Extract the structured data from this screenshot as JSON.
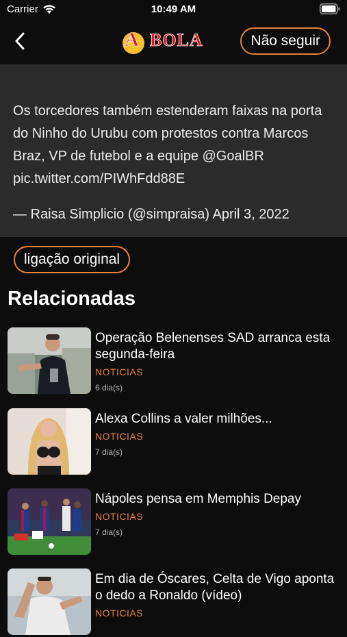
{
  "status_bar": {
    "carrier": "Carrier",
    "time": "10:49 AM"
  },
  "nav": {
    "logo_text": "A BOLA",
    "follow_label": "Não seguir"
  },
  "tweet": {
    "text": "Os torcedores também estenderam faixas na porta do Ninho do Urubu com protestos contra Marcos Braz, VP de futebol e a equipe @GoalBR",
    "url": "pic.twitter.com/PIWhFdd88E",
    "attribution": "— Raisa Simplicio (@simpraisa) April 3, 2022"
  },
  "original_link_label": "ligação original",
  "related": {
    "title": "Relacionadas",
    "items": [
      {
        "title": "Operação Belenenses SAD arranca esta segunda-feira",
        "category": "NOTICIAS",
        "time": "6 dia(s)"
      },
      {
        "title": "Alexa Collins a valer milhões...",
        "category": "NOTICIAS",
        "time": "7 dia(s)"
      },
      {
        "title": "Nápoles pensa em Memphis Depay",
        "category": "NOTICIAS",
        "time": "7 dia(s)"
      },
      {
        "title": "Em dia de Óscares, Celta de Vigo aponta o dedo a Ronaldo (vídeo)",
        "category": "NOTICIAS",
        "time": ""
      }
    ]
  },
  "colors": {
    "accent": "#e8833a",
    "background": "#0d0d0d",
    "card": "#2b2b2b",
    "logo_red": "#e3161b",
    "logo_yellow": "#f6c12a"
  }
}
